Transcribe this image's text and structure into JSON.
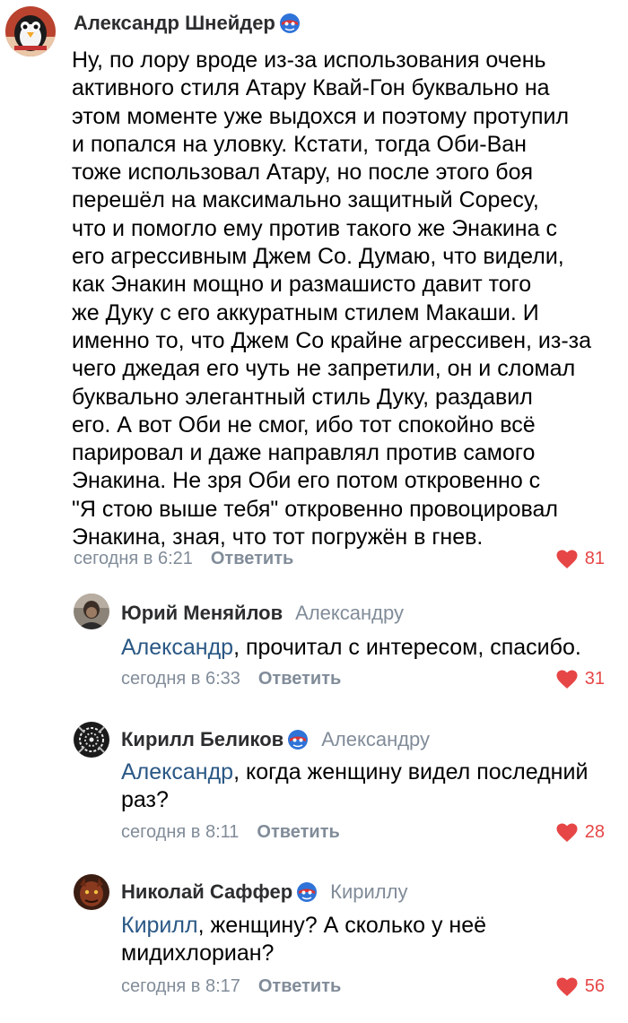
{
  "comments": [
    {
      "author": "Александр Шнейдер",
      "has_badge": true,
      "reply_to": "",
      "mention": "",
      "text": "Ну, по лору вроде из-за использования очень\nактивного стиля Атару Квай-Гон буквально на\nэтом моменте уже выдохся и поэтому протупил\nи попался на уловку. Кстати, тогда Оби-Ван\nтоже использовал Атару, но после этого боя\nперешёл на максимально защитный Соресу,\nчто и помогло ему против такого же Энакина с\nего агрессивным Джем Со. Думаю, что видели,\nкак Энакин мощно и размашисто давит того\nже Дуку с его аккуратным стилем Макаши. И\nименно то, что Джем Со крайне агрессивен, из-за\nчего джедая его чуть не запретили, он и сломал\nбуквально элегантный стиль Дуку, раздавил\nего. А вот Оби не смог, ибо тот спокойно всё\nпарировал и даже направлял против самого\nЭнакина. Не зря Оби его потом откровенно с\n\"Я стою выше тебя\" откровенно провоцировал\nЭнакина, зная, что тот погружён в гнев.",
      "time": "сегодня в 6:21",
      "reply_label": "Ответить",
      "likes": "81",
      "avatar_icon": "penguin-avatar"
    },
    {
      "author": "Юрий Меняйлов",
      "has_badge": false,
      "reply_to": "Александру",
      "mention": "Александр",
      "text": ", прочитал с интересом, спасибо.",
      "time": "сегодня в 6:33",
      "reply_label": "Ответить",
      "likes": "31",
      "avatar_icon": "man-portrait-avatar"
    },
    {
      "author": "Кирилл Беликов",
      "has_badge": true,
      "reply_to": "Александру",
      "mention": "Александр",
      "text": ", когда женщину видел последний\nраз?",
      "time": "сегодня в 8:11",
      "reply_label": "Ответить",
      "likes": "28",
      "avatar_icon": "pattern-avatar"
    },
    {
      "author": "Николай Саффер",
      "has_badge": true,
      "reply_to": "Кириллу",
      "mention": "Кирилл",
      "text": ", женщину? А сколько у неё\nмидихлориан?",
      "time": "сегодня в 8:17",
      "reply_label": "Ответить",
      "likes": "56",
      "avatar_icon": "creature-avatar"
    }
  ],
  "colors": {
    "author": "#2c2d2e",
    "muted": "#818c99",
    "mention": "#2a5885",
    "like": "#e64646"
  },
  "icons": {
    "badge": "hero-mask-badge-icon",
    "like": "heart-icon"
  }
}
